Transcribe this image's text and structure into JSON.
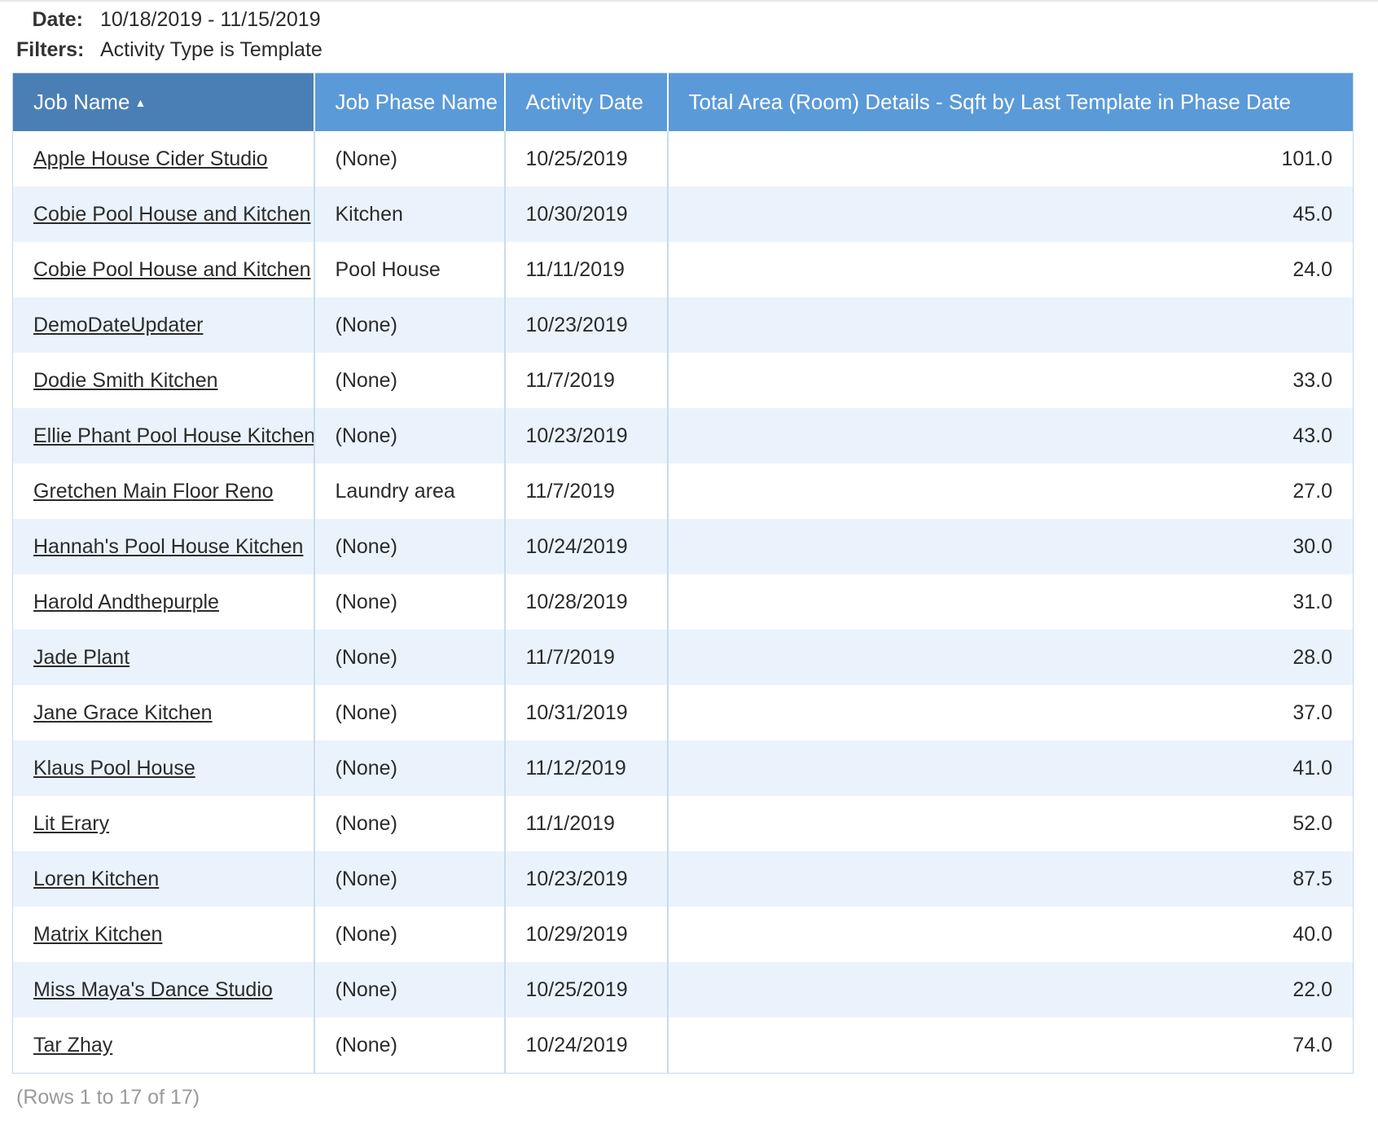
{
  "meta": {
    "date_label": "Date:",
    "date_value": "10/18/2019 - 11/15/2019",
    "filters_label": "Filters:",
    "filters_value": "Activity Type is Template"
  },
  "table": {
    "columns": [
      "Job Name",
      "Job Phase Name",
      "Activity Date",
      "Total Area (Room) Details - Sqft by Last Template in Phase Date"
    ],
    "sort": {
      "column": "Job Name",
      "direction": "ascending",
      "icon": "sort-ascending-icon"
    },
    "rows": [
      {
        "job": "Apple House Cider Studio",
        "phase": "(None)",
        "date": "10/25/2019",
        "area": "101.0"
      },
      {
        "job": "Cobie Pool House and Kitchen",
        "phase": "Kitchen",
        "date": "10/30/2019",
        "area": "45.0"
      },
      {
        "job": "Cobie Pool House and Kitchen",
        "phase": "Pool House",
        "date": "11/11/2019",
        "area": "24.0"
      },
      {
        "job": "DemoDateUpdater",
        "phase": "(None)",
        "date": "10/23/2019",
        "area": ""
      },
      {
        "job": "Dodie Smith Kitchen",
        "phase": "(None)",
        "date": "11/7/2019",
        "area": "33.0"
      },
      {
        "job": "Ellie Phant Pool House Kitchen",
        "phase": "(None)",
        "date": "10/23/2019",
        "area": "43.0"
      },
      {
        "job": "Gretchen Main Floor Reno",
        "phase": "Laundry area",
        "date": "11/7/2019",
        "area": "27.0"
      },
      {
        "job": "Hannah's Pool House Kitchen",
        "phase": "(None)",
        "date": "10/24/2019",
        "area": "30.0"
      },
      {
        "job": "Harold Andthepurple",
        "phase": "(None)",
        "date": "10/28/2019",
        "area": "31.0"
      },
      {
        "job": "Jade Plant",
        "phase": "(None)",
        "date": "11/7/2019",
        "area": "28.0"
      },
      {
        "job": "Jane Grace Kitchen",
        "phase": "(None)",
        "date": "10/31/2019",
        "area": "37.0"
      },
      {
        "job": "Klaus Pool House",
        "phase": "(None)",
        "date": "11/12/2019",
        "area": "41.0"
      },
      {
        "job": "Lit Erary",
        "phase": "(None)",
        "date": "11/1/2019",
        "area": "52.0"
      },
      {
        "job": "Loren Kitchen",
        "phase": "(None)",
        "date": "10/23/2019",
        "area": "87.5"
      },
      {
        "job": "Matrix Kitchen",
        "phase": "(None)",
        "date": "10/29/2019",
        "area": "40.0"
      },
      {
        "job": "Miss Maya's Dance Studio",
        "phase": "(None)",
        "date": "10/25/2019",
        "area": "22.0"
      },
      {
        "job": "Tar Zhay",
        "phase": "(None)",
        "date": "10/24/2019",
        "area": "74.0"
      }
    ]
  },
  "footer": {
    "row_count": "(Rows 1 to 17 of 17)"
  },
  "colors": {
    "header_sorted": "#4a7fb5",
    "header": "#5b9ad8",
    "row_alt": "#eaf3fc",
    "border": "#c9dcee"
  }
}
